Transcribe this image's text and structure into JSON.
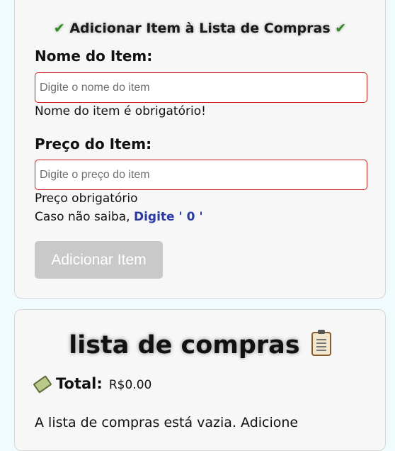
{
  "form": {
    "check_symbol": "✔",
    "title": "Adicionar Item à Lista de Compras",
    "name_label": "Nome do Item:",
    "name_placeholder": "Digite o nome do item",
    "name_value": "",
    "name_error": "Nome do item é obrigatório!",
    "price_label": "Preço do Item:",
    "price_placeholder": "Digite o preço do item",
    "price_value": "",
    "price_error": "Preço obrigatório",
    "price_hint_prefix": "Caso não saiba,",
    "price_hint_action": "Digite ' 0 '",
    "submit_label": "Adicionar Item"
  },
  "list": {
    "title": "lista de compras",
    "title_icon": "clipboard-icon",
    "total_icon": "money-icon",
    "total_label": "Total:",
    "total_value": "R$0.00",
    "empty_message": "A lista de compras está vazia. Adicione"
  },
  "colors": {
    "background": "#f0fbfd",
    "card": "#f7f7f7",
    "input_error_border": "#cc1b1b",
    "hint_accent": "#2b3ba6",
    "button_disabled": "#c9c9c9",
    "check_green": "#2e8b1f"
  }
}
